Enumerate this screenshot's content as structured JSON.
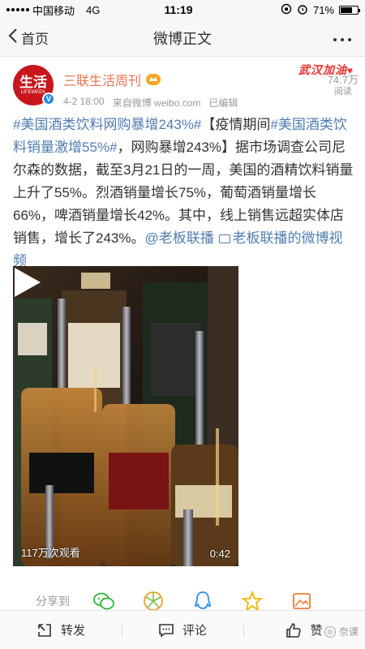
{
  "status_bar": {
    "carrier": "中国移动",
    "network": "4G",
    "time": "11:19",
    "battery_pct": "71%",
    "battery_level": 0.71
  },
  "nav": {
    "back_label": "首页",
    "title": "微博正文",
    "more_label": "···"
  },
  "author": {
    "avatar_big": "生活",
    "avatar_small": "LIFEWEEK",
    "name": "三联生活周刊",
    "time": "4-2 18:00",
    "source": "来自微博 weibo.com",
    "edited": "已编辑",
    "badge": "武汉加油",
    "read_count": "74.7万",
    "read_label": "阅读"
  },
  "post": {
    "tag1": "#美国酒类饮料网购暴增243%#",
    "bracket_open": "【疫情期间",
    "tag2": "#美国酒类饮料销量激增55%#",
    "bracket_rest": "，网购暴增243%】据市场调查公司尼尔森的数据，截至3月21日的一周，美国的酒精饮料销量上升了55%。烈酒销量增长75%，葡萄酒销量增长66%，啤酒销量增长42%。其中，线上销售远超实体店销售，增长了243%。",
    "mention": "@老板联播",
    "video_link": "老板联播的微博视频"
  },
  "video": {
    "views": "117万次观看",
    "duration": "0:42"
  },
  "share": {
    "label": "分享到"
  },
  "actions": {
    "repost": "转发",
    "comment": "评论",
    "like": "赞"
  },
  "watermark": "奈课",
  "colors": {
    "link": "#507daf",
    "author": "#eb7350",
    "brand_red": "#c8161d"
  }
}
